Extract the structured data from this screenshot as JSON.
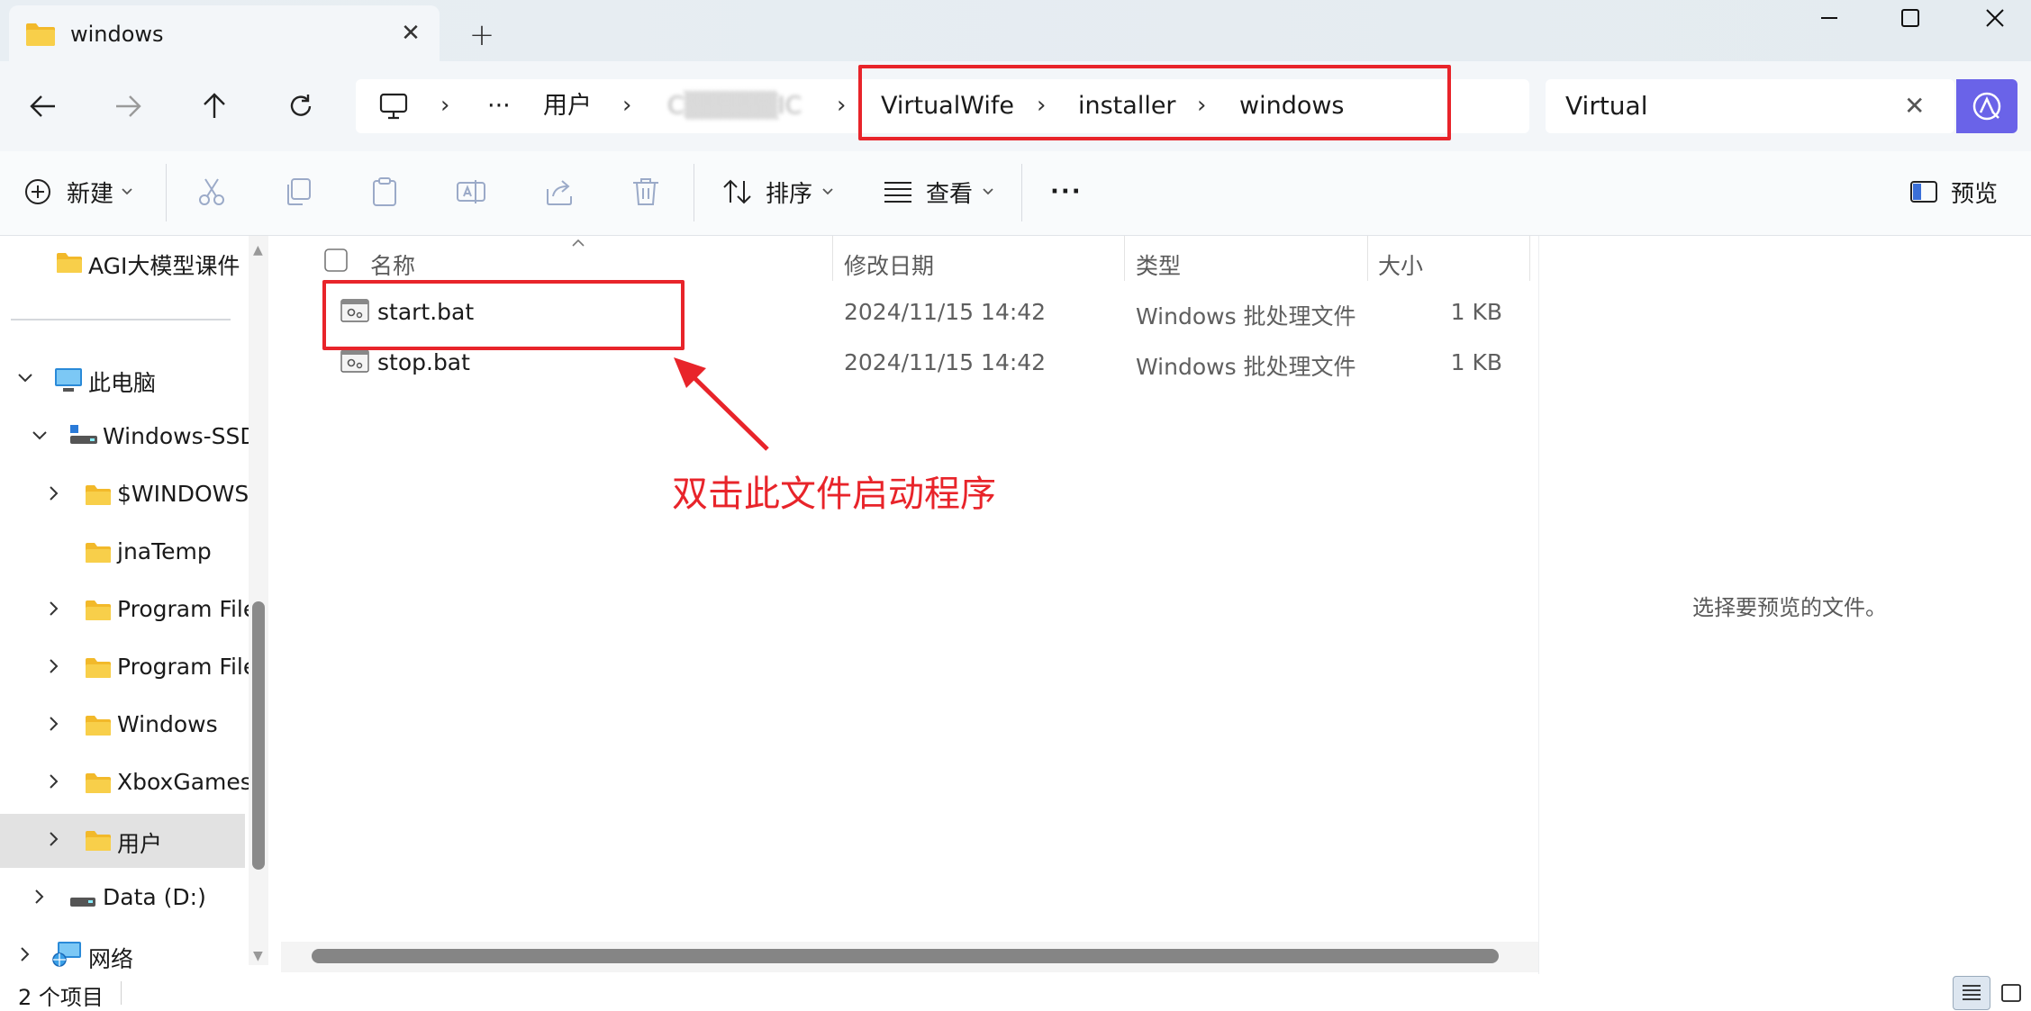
{
  "window": {
    "tab_title": "windows",
    "new_tab_label": "+",
    "close_tab_label": "✕"
  },
  "address": {
    "crumbs": [
      "用户",
      "C▒▒▒▒▒IC",
      "VirtualWife",
      "installer",
      "windows"
    ],
    "overflow": "···"
  },
  "search": {
    "value": "Virtual",
    "clear_label": "✕"
  },
  "toolbar": {
    "new_label": "新建",
    "sort_label": "排序",
    "view_label": "查看",
    "more_label": "···",
    "preview_label": "预览"
  },
  "sidebar": {
    "items": [
      {
        "label": "AGI大模型课件"
      },
      {
        "label": "此电脑"
      },
      {
        "label": "Windows-SSD"
      },
      {
        "label": "$WINDOWS"
      },
      {
        "label": "jnaTemp"
      },
      {
        "label": "Program File"
      },
      {
        "label": "Program File"
      },
      {
        "label": "Windows"
      },
      {
        "label": "XboxGames"
      },
      {
        "label": "用户"
      },
      {
        "label": "Data (D:)"
      },
      {
        "label": "网络"
      }
    ]
  },
  "columns": {
    "name": "名称",
    "modified": "修改日期",
    "type": "类型",
    "size": "大小"
  },
  "files": [
    {
      "name": "start.bat",
      "modified": "2024/11/15 14:42",
      "type": "Windows 批处理文件",
      "size": "1 KB"
    },
    {
      "name": "stop.bat",
      "modified": "2024/11/15 14:42",
      "type": "Windows 批处理文件",
      "size": "1 KB"
    }
  ],
  "annotation": {
    "text": "双击此文件启动程序",
    "color": "#e8242a"
  },
  "preview_pane": {
    "message": "选择要预览的文件。"
  },
  "status": {
    "item_count": "2 个项目"
  },
  "colors": {
    "accent": "#6a63e8",
    "highlight": "#e8242a",
    "folder": "#f5c842"
  }
}
